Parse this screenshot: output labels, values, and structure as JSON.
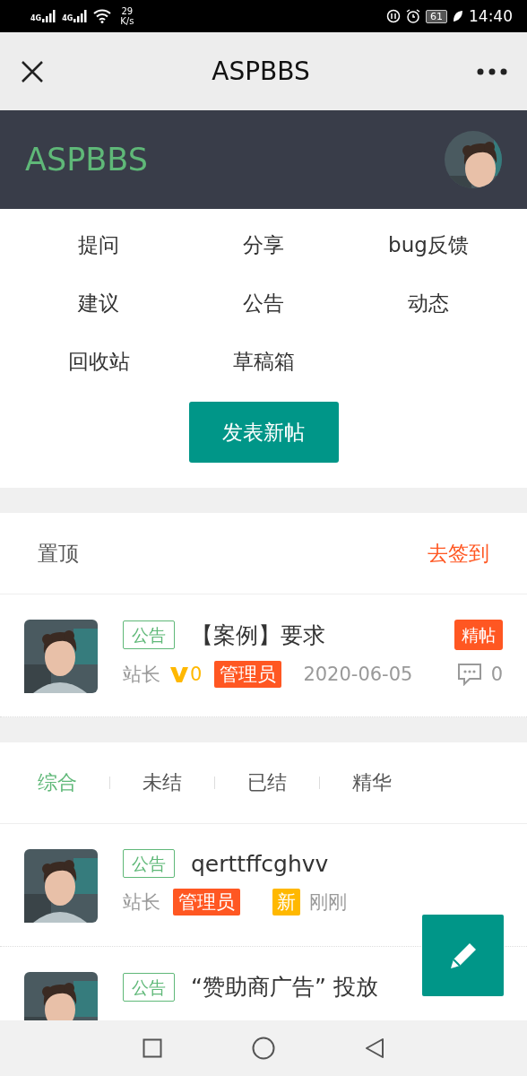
{
  "status_bar": {
    "carriers": [
      "4G",
      "4G"
    ],
    "speed_value": "29",
    "speed_unit": "K/s",
    "battery": "61",
    "time": "14:40"
  },
  "nav_bar": {
    "title": "ASPBBS"
  },
  "header": {
    "site_name": "ASPBBS"
  },
  "menu": {
    "items": [
      "提问",
      "分享",
      "bug反馈",
      "建议",
      "公告",
      "动态",
      "回收站",
      "草稿箱"
    ],
    "post_button": "发表新帖"
  },
  "pinned": {
    "title": "置顶",
    "checkin_link": "去签到",
    "posts": [
      {
        "tag": "公告",
        "title": "【案例】要求",
        "featured": "精帖",
        "author": "站长",
        "vip": "0",
        "role": "管理员",
        "date": "2020-06-05",
        "comments": "0"
      }
    ]
  },
  "feed": {
    "tabs": [
      {
        "label": "综合",
        "selected": true
      },
      {
        "label": "未结",
        "selected": false
      },
      {
        "label": "已结",
        "selected": false
      },
      {
        "label": "精华",
        "selected": false
      }
    ],
    "posts": [
      {
        "tag": "公告",
        "title": "qerttffcghvv",
        "author": "站长",
        "role": "管理员",
        "new_badge": "新",
        "date": "刚刚"
      },
      {
        "tag": "公告",
        "title": "“赞助商广告” 投放"
      }
    ]
  }
}
